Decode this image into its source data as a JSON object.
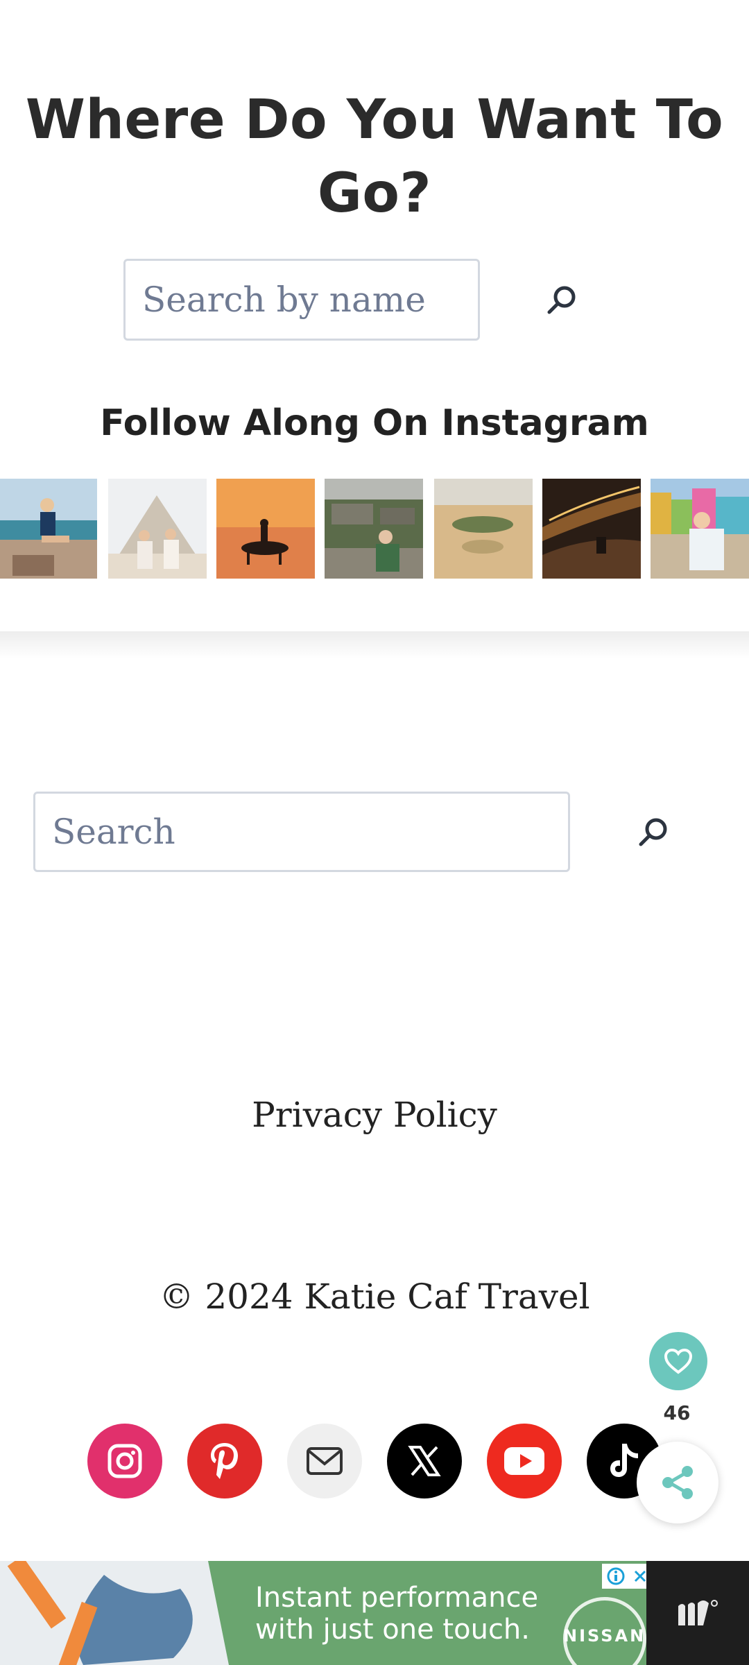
{
  "hero": {
    "title": "Where Do You Want To Go?"
  },
  "destination_search": {
    "placeholder": "Search by name",
    "value": ""
  },
  "instagram": {
    "heading": "Follow Along On Instagram",
    "photos": [
      "beach-rocks-photo",
      "pyramids-photo",
      "horse-sunset-photo",
      "ruins-photo",
      "desert-oasis-photo",
      "night-dunes-photo",
      "colorful-houses-photo"
    ]
  },
  "site_search": {
    "placeholder": "Search",
    "value": ""
  },
  "footer": {
    "privacy_link": "Privacy Policy",
    "copyright": "© 2024 Katie Caf Travel"
  },
  "social": [
    {
      "name": "instagram",
      "color": "#e1306c"
    },
    {
      "name": "pinterest",
      "color": "#e02a2a"
    },
    {
      "name": "email",
      "color": "#efefef"
    },
    {
      "name": "x",
      "color": "#000000"
    },
    {
      "name": "youtube",
      "color": "#ee2a1f"
    },
    {
      "name": "tiktok",
      "color": "#000000"
    }
  ],
  "floating": {
    "share_count": "46",
    "favorite_color": "#6cc7bd"
  },
  "ad": {
    "text_line1": "Instant performance",
    "text_line2": "with just one touch.",
    "brand": "NISSAN"
  }
}
